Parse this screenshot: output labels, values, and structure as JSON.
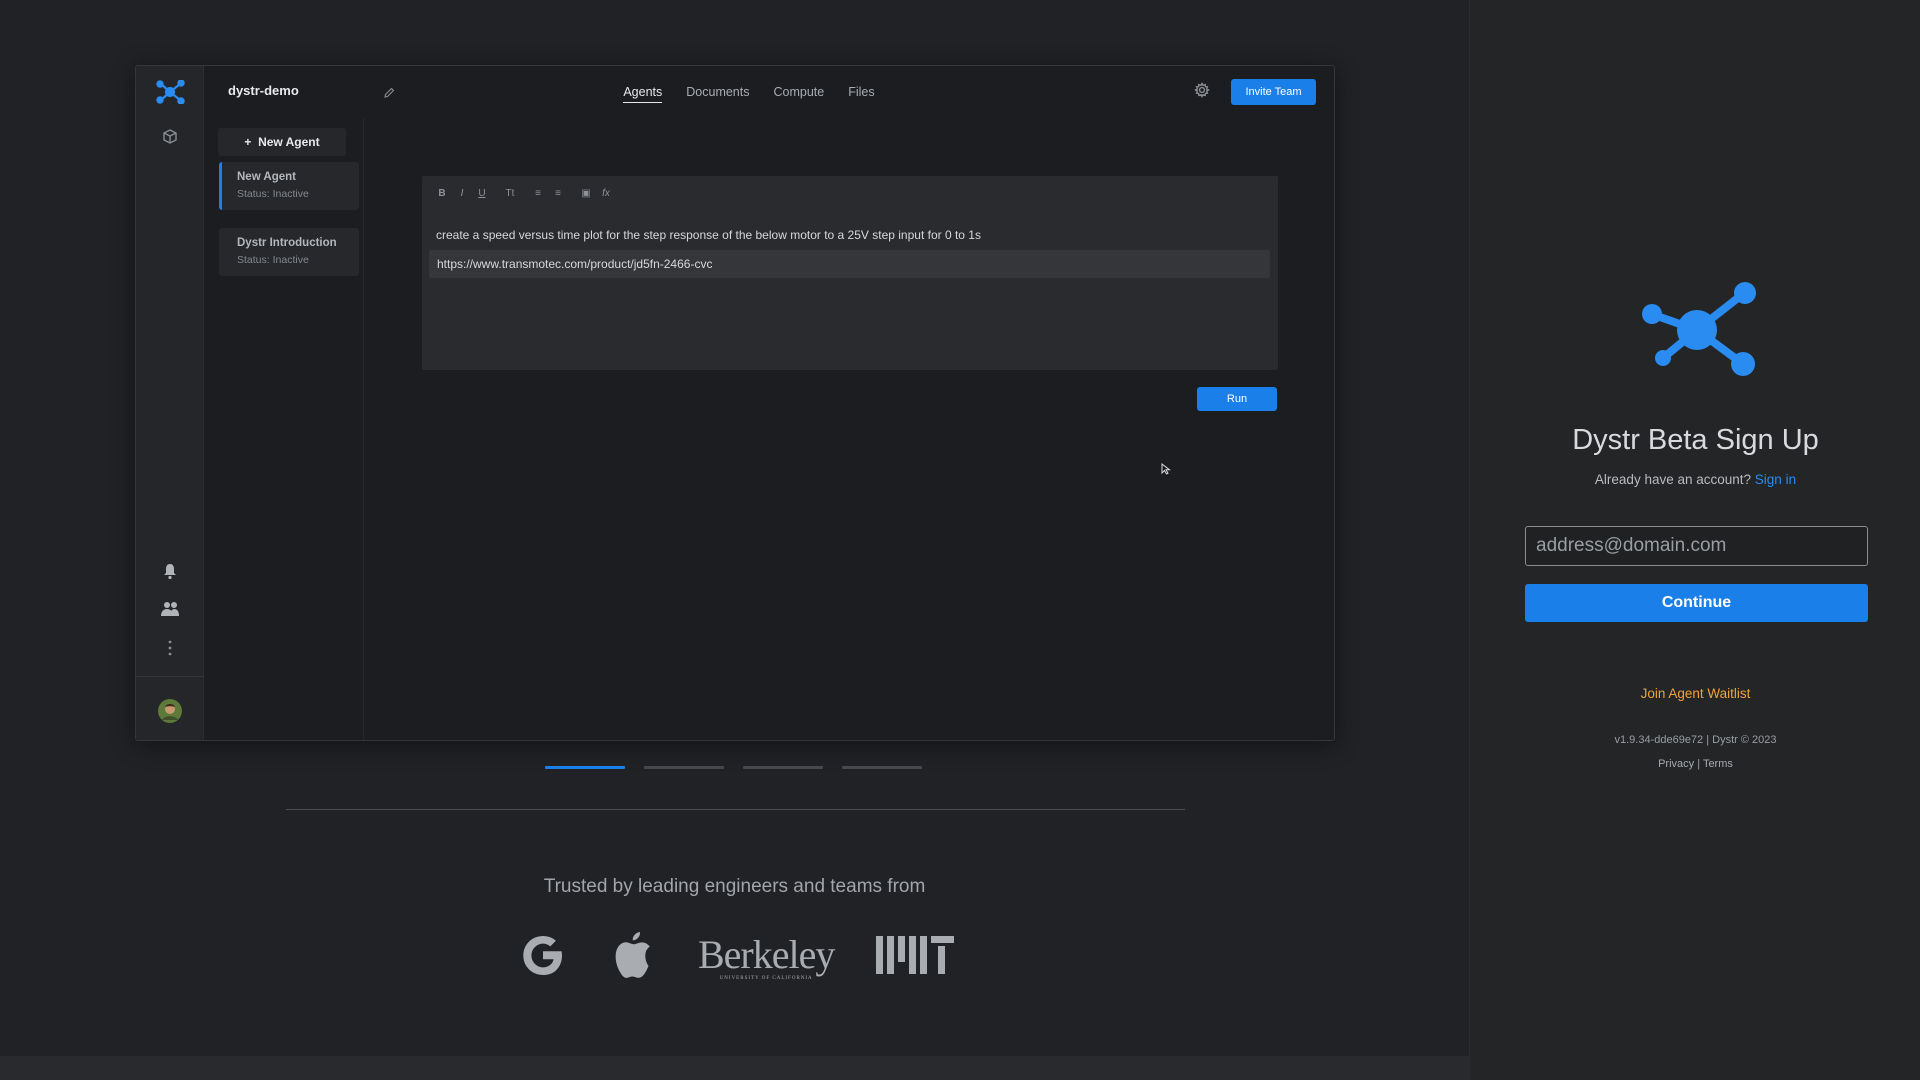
{
  "demo": {
    "project_name": "dystr-demo",
    "nav_tabs": [
      {
        "label": "Agents",
        "active": true
      },
      {
        "label": "Documents",
        "active": false
      },
      {
        "label": "Compute",
        "active": false
      },
      {
        "label": "Files",
        "active": false
      }
    ],
    "invite_label": "Invite Team",
    "new_agent_label": "New Agent",
    "agents": [
      {
        "name": "New Agent",
        "status": "Status: Inactive"
      },
      {
        "name": "Dystr Introduction",
        "status": "Status: Inactive"
      }
    ],
    "editor": {
      "toolbar": [
        "B",
        "I",
        "U",
        "Tt",
        "≡",
        "≡",
        "▣",
        "fx"
      ],
      "prompt": "create a speed versus time plot for the step response of the below motor to a 25V step input for 0 to 1s",
      "url": "https://www.transmotec.com/product/jd5fn-2466-cvc"
    },
    "run_label": "Run"
  },
  "carousel": {
    "count": 4,
    "active_index": 0
  },
  "trusted_text": "Trusted by leading engineers and teams from",
  "logos": {
    "google": "G",
    "apple": "apple-logo",
    "berkeley_main": "Berkeley",
    "berkeley_sub": "UNIVERSITY OF CALIFORNIA",
    "mit": "mit-logo"
  },
  "signup": {
    "title": "Dystr Beta Sign Up",
    "account_prompt": "Already have an account?",
    "signin_label": "Sign in",
    "email_placeholder": "address@domain.com",
    "continue_label": "Continue",
    "waitlist_label": "Join Agent Waitlist",
    "version": "v1.9.34-dde69e72 | Dystr © 2023",
    "privacy_label": "Privacy",
    "separator": "|",
    "terms_label": "Terms"
  },
  "colors": {
    "accent": "#1a7fe8",
    "waitlist": "#f0a23a",
    "link": "#2a8cf0"
  }
}
